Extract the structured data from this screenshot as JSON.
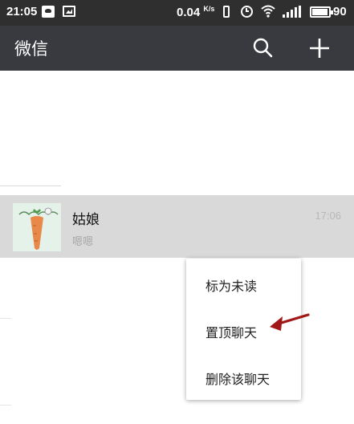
{
  "status_bar": {
    "time": "21:05",
    "speed_value": "0.04",
    "speed_unit": "K/s",
    "battery": "90",
    "icons": [
      "message-icon",
      "image-icon",
      "vibrate-icon",
      "alarm-icon",
      "wifi-icon",
      "signal-icon",
      "battery-icon"
    ]
  },
  "appbar": {
    "title": "微信",
    "search_icon": "search-icon",
    "add_icon": "plus-icon"
  },
  "chat": {
    "name": "姑娘",
    "preview": "嗯嗯",
    "time": "17:06",
    "avatar": "carrot-avatar"
  },
  "context_menu": {
    "items": [
      "标为未读",
      "置顶聊天",
      "删除该聊天"
    ]
  },
  "colors": {
    "appbar": "#393a3f",
    "statusbar": "#2f2f2f",
    "selected_row": "#d9d9d9",
    "arrow": "#a01818"
  }
}
